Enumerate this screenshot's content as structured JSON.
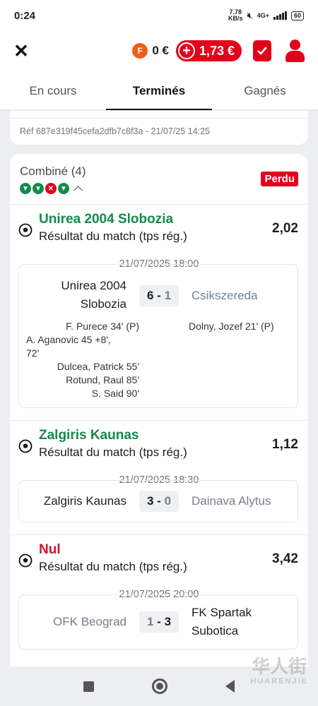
{
  "status_bar": {
    "time": "0:24",
    "speed": "7.78",
    "speed_unit": "KB/s",
    "network": "4G+",
    "battery": "60"
  },
  "header": {
    "freebet_balance": "0 €",
    "balance": "1,73 €",
    "freebet_icon_letter": "F"
  },
  "tabs": [
    {
      "label": "En cours",
      "active": false
    },
    {
      "label": "Terminés",
      "active": true
    },
    {
      "label": "Gagnés",
      "active": false
    }
  ],
  "previous_bet": {
    "reference": "Réf 687e319f45cefa2dfb7c8f3a - 21/07/25 14:25"
  },
  "bet": {
    "title": "Combiné (4)",
    "status": "Perdu",
    "leg_results": [
      "win",
      "win",
      "lose",
      "win"
    ],
    "selections": [
      {
        "pick": "Unirea 2004 Slobozia",
        "market": "Résultat du match (tps rég.)",
        "odds": "2,02",
        "result": "win",
        "kickoff": "21/07/2025 18:00",
        "home": "Unirea 2004 Slobozia",
        "home_line1": "Unirea 2004",
        "home_line2": "Slobozia",
        "away": "Csikszereda",
        "home_score": "6",
        "away_score": "1",
        "score_sep": "-",
        "home_scorers": [
          "F. Purece 34' (P)",
          "A. Aganovic 45 +8',",
          "72'",
          "Dulcea, Patrick 55'",
          "Rotund, Raul 85'",
          "S. Said 90'"
        ],
        "away_scorers": [
          "Dolny, Jozef 21' (P)"
        ]
      },
      {
        "pick": "Zalgiris Kaunas",
        "market": "Résultat du match (tps rég.)",
        "odds": "1,12",
        "result": "win",
        "kickoff": "21/07/2025 18:30",
        "home": "Zalgiris Kaunas",
        "away": "Dainava Alytus",
        "home_score": "3",
        "away_score": "0",
        "score_sep": "-"
      },
      {
        "pick": "Nul",
        "market": "Résultat du match (tps rég.)",
        "odds": "3,42",
        "result": "lose",
        "kickoff": "21/07/2025 20:00",
        "home": "OFK Beograd",
        "away_line1": "FK Spartak",
        "away_line2": "Subotica",
        "home_score": "1",
        "away_score": "3",
        "score_sep": "-"
      }
    ]
  },
  "watermark": {
    "chinese": "华人街",
    "latin": "HUARENJIE"
  },
  "colors": {
    "brand_red": "#e3001b",
    "win_green": "#138a4a",
    "muted": "#75808f"
  }
}
